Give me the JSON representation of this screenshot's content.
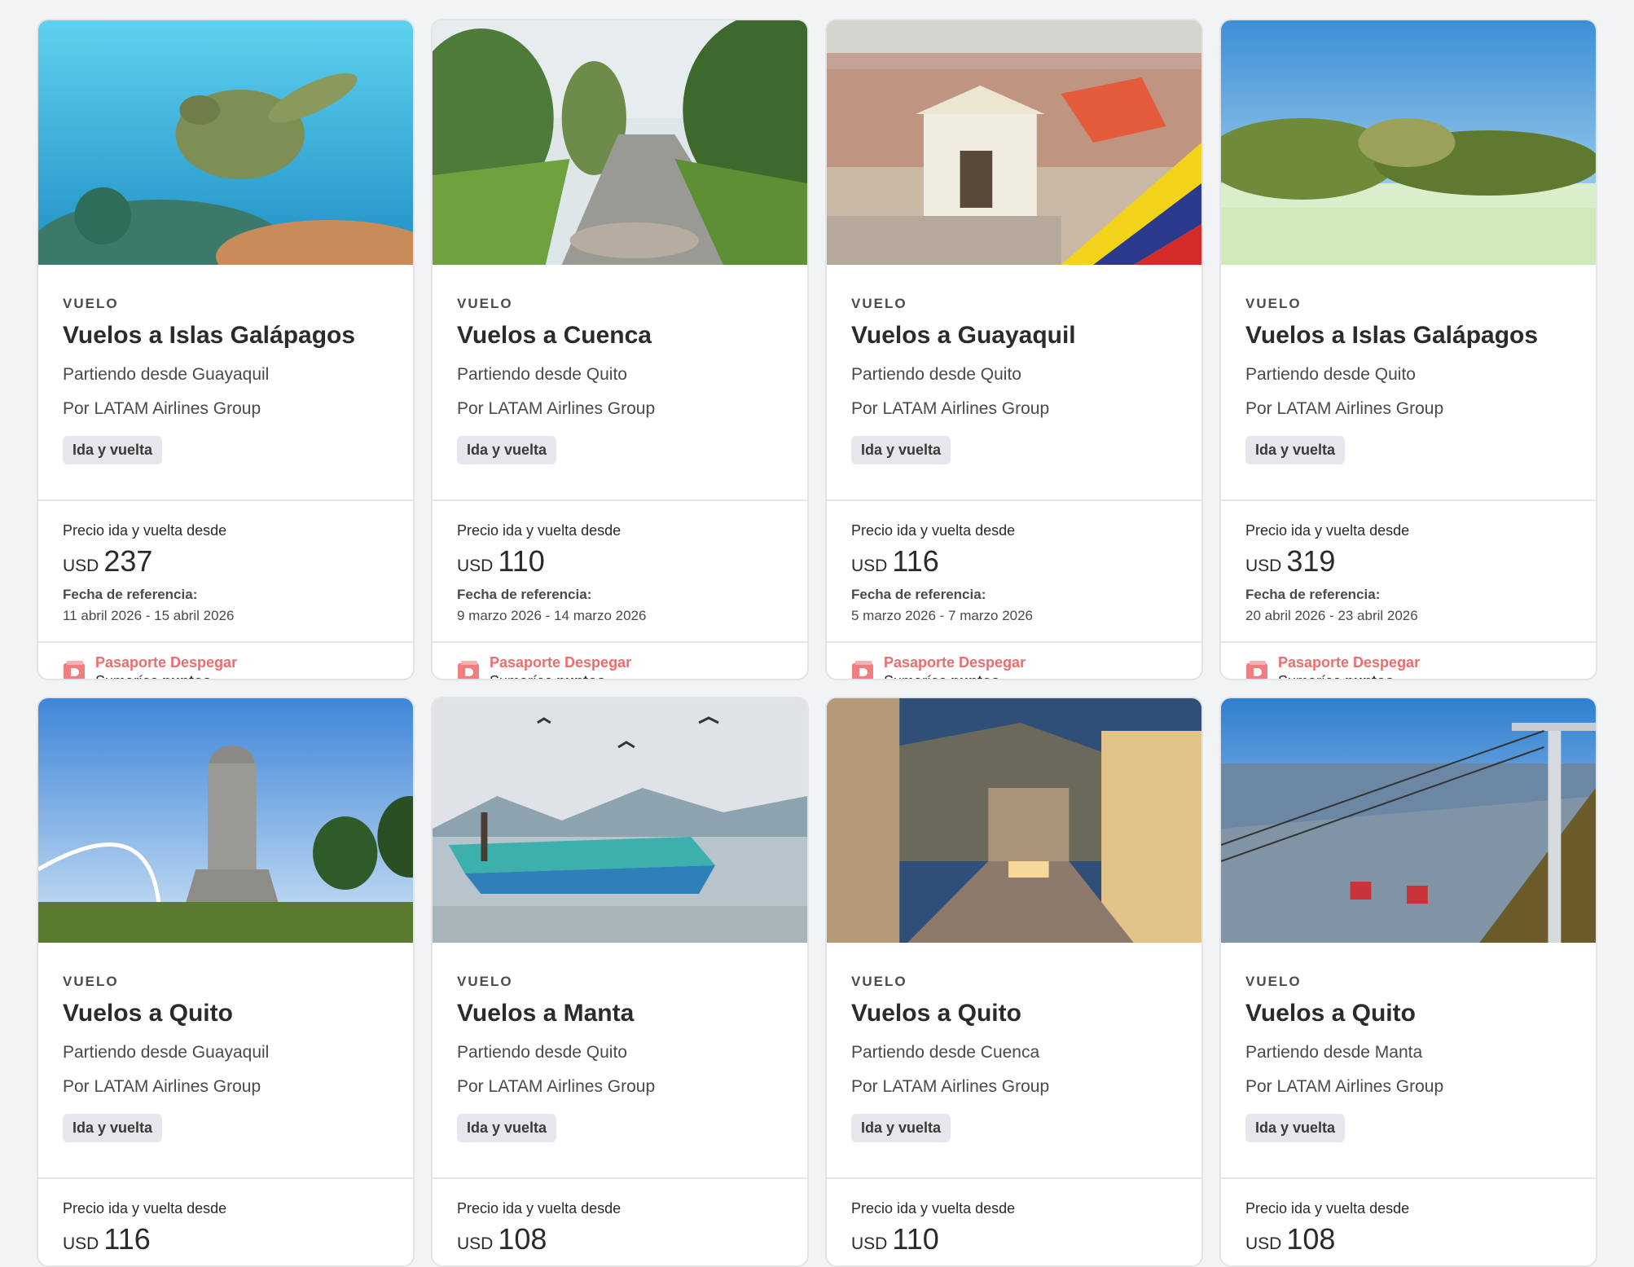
{
  "cards": [
    {
      "kind": "VUELO",
      "title": "Vuelos a Islas Galápagos",
      "origin": "Partiendo desde Guayaquil",
      "airline": "Por LATAM Airlines Group",
      "tag": "Ida y vuelta",
      "price_label": "Precio ida y vuelta desde",
      "currency": "USD",
      "price": "237",
      "ref_label": "Fecha de referencia:",
      "ref_dates": "11 abril 2026 - 15 abril 2026",
      "pass_title": "Pasaporte Despegar",
      "pass_sub": "Sumarías",
      "pass_sub_bold": "puntos",
      "photo": "sea-turtle-underwater"
    },
    {
      "kind": "VUELO",
      "title": "Vuelos a Cuenca",
      "origin": "Partiendo desde Quito",
      "airline": "Por LATAM Airlines Group",
      "tag": "Ida y vuelta",
      "price_label": "Precio ida y vuelta desde",
      "currency": "USD",
      "price": "110",
      "ref_label": "Fecha de referencia:",
      "ref_dates": "9 marzo 2026 - 14 marzo 2026",
      "pass_title": "Pasaporte Despegar",
      "pass_sub": "Sumarías",
      "pass_sub_bold": "puntos",
      "photo": "river-with-trees"
    },
    {
      "kind": "VUELO",
      "title": "Vuelos a Guayaquil",
      "origin": "Partiendo desde Quito",
      "airline": "Por LATAM Airlines Group",
      "tag": "Ida y vuelta",
      "price_label": "Precio ida y vuelta desde",
      "currency": "USD",
      "price": "116",
      "ref_label": "Fecha de referencia:",
      "ref_dates": "5 marzo 2026 - 7 marzo 2026",
      "pass_title": "Pasaporte Despegar",
      "pass_sub": "Sumarías",
      "pass_sub_bold": "puntos",
      "photo": "church-and-flag"
    },
    {
      "kind": "VUELO",
      "title": "Vuelos a Islas Galápagos",
      "origin": "Partiendo desde Quito",
      "airline": "Por LATAM Airlines Group",
      "tag": "Ida y vuelta",
      "price_label": "Precio ida y vuelta desde",
      "currency": "USD",
      "price": "319",
      "ref_label": "Fecha de referencia:",
      "ref_dates": "20 abril 2026 - 23 abril 2026",
      "pass_title": "Pasaporte Despegar",
      "pass_sub": "Sumarías",
      "pass_sub_bold": "puntos",
      "photo": "island-lagoon"
    },
    {
      "kind": "VUELO",
      "title": "Vuelos a Quito",
      "origin": "Partiendo desde Guayaquil",
      "airline": "Por LATAM Airlines Group",
      "tag": "Ida y vuelta",
      "price_label": "Precio ida y vuelta desde",
      "currency": "USD",
      "price": "116",
      "photo": "virgin-statue"
    },
    {
      "kind": "VUELO",
      "title": "Vuelos a Manta",
      "origin": "Partiendo desde Quito",
      "airline": "Por LATAM Airlines Group",
      "tag": "Ida y vuelta",
      "price_label": "Precio ida y vuelta desde",
      "currency": "USD",
      "price": "108",
      "photo": "fishing-boats"
    },
    {
      "kind": "VUELO",
      "title": "Vuelos a Quito",
      "origin": "Partiendo desde Cuenca",
      "airline": "Por LATAM Airlines Group",
      "tag": "Ida y vuelta",
      "price_label": "Precio ida y vuelta desde",
      "currency": "USD",
      "price": "110",
      "photo": "colonial-street"
    },
    {
      "kind": "VUELO",
      "title": "Vuelos a Quito",
      "origin": "Partiendo desde Manta",
      "airline": "Por LATAM Airlines Group",
      "tag": "Ida y vuelta",
      "price_label": "Precio ida y vuelta desde",
      "currency": "USD",
      "price": "108",
      "photo": "cable-car"
    }
  ],
  "colors": {
    "accent": "#ee6b6e",
    "tag_bg": "#e6e7ec",
    "page_bg": "#f2f3f5"
  }
}
